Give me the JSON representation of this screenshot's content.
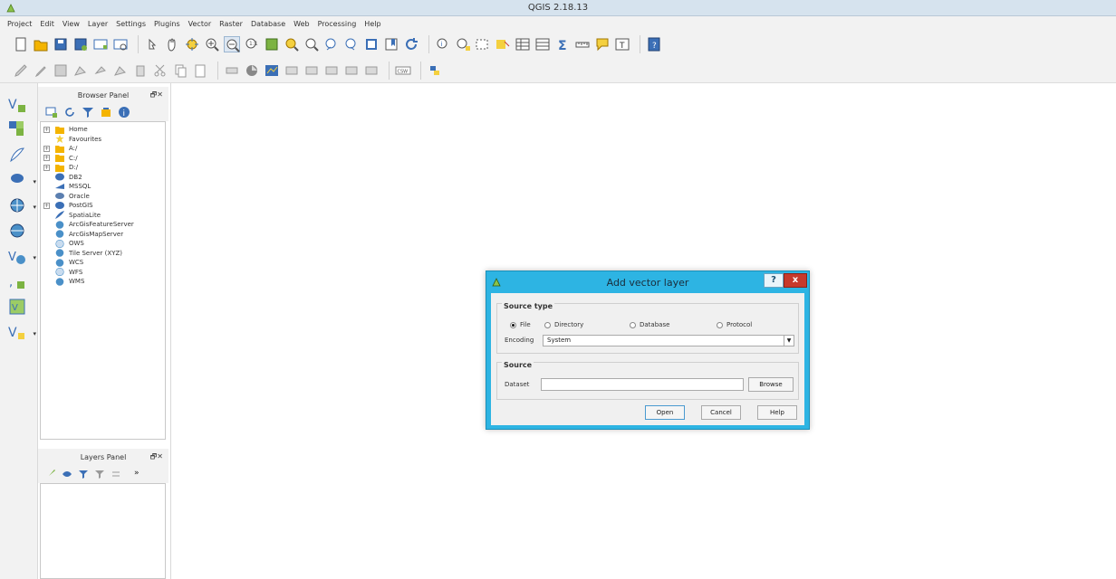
{
  "window": {
    "title": "QGIS 2.18.13"
  },
  "menu": [
    "Project",
    "Edit",
    "View",
    "Layer",
    "Settings",
    "Plugins",
    "Vector",
    "Raster",
    "Database",
    "Web",
    "Processing",
    "Help"
  ],
  "browser_panel": {
    "title": "Browser Panel",
    "items": [
      {
        "label": "Home",
        "icon": "folder-icon",
        "expandable": true
      },
      {
        "label": "Favourites",
        "icon": "star-icon",
        "expandable": false
      },
      {
        "label": "A:/",
        "icon": "folder-icon",
        "expandable": true
      },
      {
        "label": "C:/",
        "icon": "folder-icon",
        "expandable": true
      },
      {
        "label": "D:/",
        "icon": "folder-icon",
        "expandable": true
      },
      {
        "label": "DB2",
        "icon": "database-icon",
        "expandable": false
      },
      {
        "label": "MSSQL",
        "icon": "database-icon",
        "expandable": false
      },
      {
        "label": "Oracle",
        "icon": "database-icon",
        "expandable": false
      },
      {
        "label": "PostGIS",
        "icon": "elephant-icon",
        "expandable": true
      },
      {
        "label": "SpatiaLite",
        "icon": "feather-icon",
        "expandable": false
      },
      {
        "label": "ArcGisFeatureServer",
        "icon": "globe-icon",
        "expandable": false
      },
      {
        "label": "ArcGisMapServer",
        "icon": "globe-icon",
        "expandable": false
      },
      {
        "label": "OWS",
        "icon": "globe-icon",
        "expandable": false
      },
      {
        "label": "Tile Server (XYZ)",
        "icon": "globe-icon",
        "expandable": false
      },
      {
        "label": "WCS",
        "icon": "globe-icon",
        "expandable": false
      },
      {
        "label": "WFS",
        "icon": "globe-icon",
        "expandable": false
      },
      {
        "label": "WMS",
        "icon": "globe-icon",
        "expandable": false
      }
    ]
  },
  "layers_panel": {
    "title": "Layers Panel"
  },
  "dialog": {
    "title": "Add vector layer",
    "help_label": "?",
    "close_label": "x",
    "source_type": {
      "label": "Source type",
      "options": [
        "File",
        "Directory",
        "Database",
        "Protocol"
      ],
      "selected": "File"
    },
    "encoding": {
      "label": "Encoding",
      "value": "System"
    },
    "source": {
      "label": "Source",
      "dataset_label": "Dataset",
      "dataset_value": "",
      "browse_label": "Browse"
    },
    "buttons": {
      "open": "Open",
      "cancel": "Cancel",
      "help": "Help"
    }
  },
  "colors": {
    "dialog_frame": "#2db4e3",
    "close_button": "#c7392b",
    "titlebar": "#d6e3ee"
  }
}
